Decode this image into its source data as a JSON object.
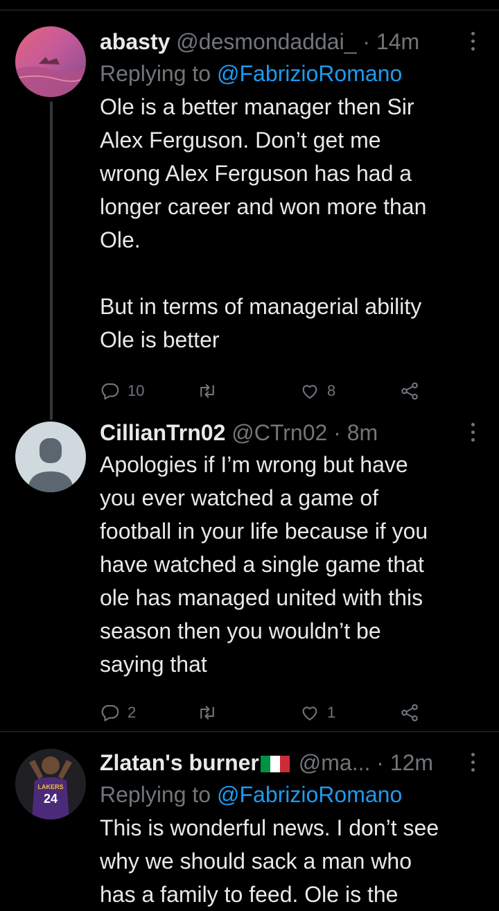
{
  "tweets": [
    {
      "name": "abasty",
      "handle": "@desmondaddai_",
      "dot": "·",
      "time": "14m",
      "replying_prefix": "Replying to",
      "replying_to": "@FabrizioRomano",
      "body": "Ole is a better manager then Sir\nAlex Ferguson. Don’t get me\nwrong Alex Ferguson has had a\nlonger career and won more than\nOle.\n\nBut in terms of managerial ability\nOle is better",
      "replies": "10",
      "retweets": "",
      "likes": "8"
    },
    {
      "name": "CillianTrn02",
      "handle": "@CTrn02",
      "dot": "·",
      "time": "8m",
      "body": "Apologies if I’m wrong but have\nyou ever watched a game of\nfootball in your life because if you\nhave watched a single game that\nole has managed united with this\nseason then you wouldn’t be\nsaying that",
      "replies": "2",
      "retweets": "",
      "likes": "1"
    },
    {
      "name": "Zlatan's burner",
      "handle": "@ma...",
      "dot": "·",
      "time": "12m",
      "replying_prefix": "Replying to",
      "replying_to": "@FabrizioRomano",
      "body": "This is wonderful news. I don’t see\nwhy we should sack a man who\nhas a family to feed. Ole is the",
      "avatar_jersey_text": "LAKERS",
      "avatar_jersey_number": "24"
    }
  ],
  "colors": {
    "background": "#000000",
    "text": "#e7e9ea",
    "secondary": "#71767b",
    "accent": "#1d9bf0",
    "divider": "#2f3336"
  },
  "icons": [
    "reply-icon",
    "retweet-icon",
    "like-icon",
    "share-icon",
    "more-icon",
    "italy-flag-icon"
  ]
}
